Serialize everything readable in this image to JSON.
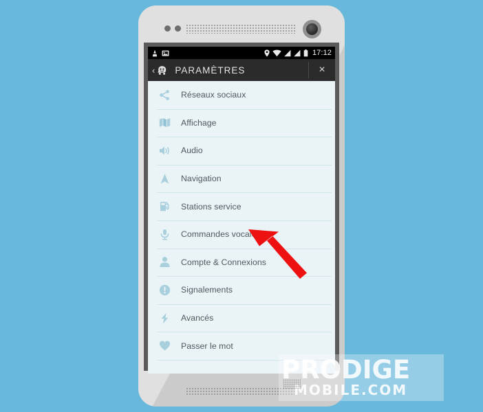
{
  "theme": {
    "page_background": "#68b8db",
    "phone_body": "#d2d2d2",
    "bezel": "#5a5a5a",
    "screen_background": "#eaf3f6",
    "title_bar": "#2b2b2b",
    "status_bar": "#000000",
    "divider": "#cfe3ea",
    "icon_tint": "#a9cfdd",
    "label_text": "#4c5b61",
    "arrow_color": "#ee1111"
  },
  "status_bar": {
    "left_icons": [
      "vlc-cone-icon",
      "image-icon"
    ],
    "right_icons": [
      "location-pin-icon",
      "wifi-icon",
      "signal-bars-icon",
      "signal-bars-2-icon",
      "battery-icon"
    ],
    "clock": "17:12"
  },
  "title_bar": {
    "back_chevron": "‹",
    "app_icon": "waze-face-icon",
    "title": "PARAMÈTRES",
    "close_label": "×"
  },
  "settings_list": [
    {
      "icon": "share-nodes-icon",
      "label": "Réseaux sociaux"
    },
    {
      "icon": "map-icon",
      "label": "Affichage"
    },
    {
      "icon": "speaker-icon",
      "label": "Audio"
    },
    {
      "icon": "navigation-arrow-icon",
      "label": "Navigation"
    },
    {
      "icon": "fuel-pump-icon",
      "label": "Stations service"
    },
    {
      "icon": "microphone-icon",
      "label": "Commandes vocales"
    },
    {
      "icon": "person-icon",
      "label": "Compte & Connexions"
    },
    {
      "icon": "alert-circle-icon",
      "label": "Signalements"
    },
    {
      "icon": "lightning-bolt-icon",
      "label": "Avancés"
    },
    {
      "icon": "heart-icon",
      "label": "Passer le mot"
    }
  ],
  "annotation": {
    "arrow": "red-arrow-pointing-up-left",
    "points_at": "Commandes vocales"
  },
  "watermark": {
    "line1": "PRODIGE",
    "line2": "MOBILE.COM"
  }
}
